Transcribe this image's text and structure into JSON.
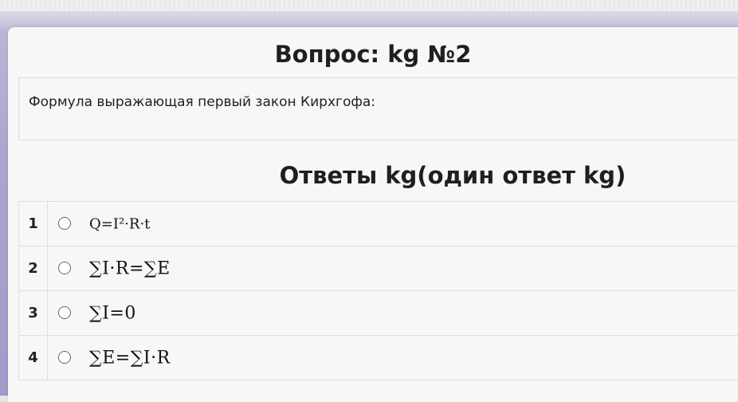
{
  "question": {
    "title": "Вопрос: kg №2",
    "text": "Формула выражающая первый закон Кирхгофа:"
  },
  "answers_title": "Ответы kg(один ответ kg)",
  "answers": [
    {
      "number": "1",
      "formula": "Q=I²·R·t"
    },
    {
      "number": "2",
      "formula": "∑I·R=∑E"
    },
    {
      "number": "3",
      "formula": "∑I=0"
    },
    {
      "number": "4",
      "formula": "∑E=∑I·R"
    }
  ]
}
